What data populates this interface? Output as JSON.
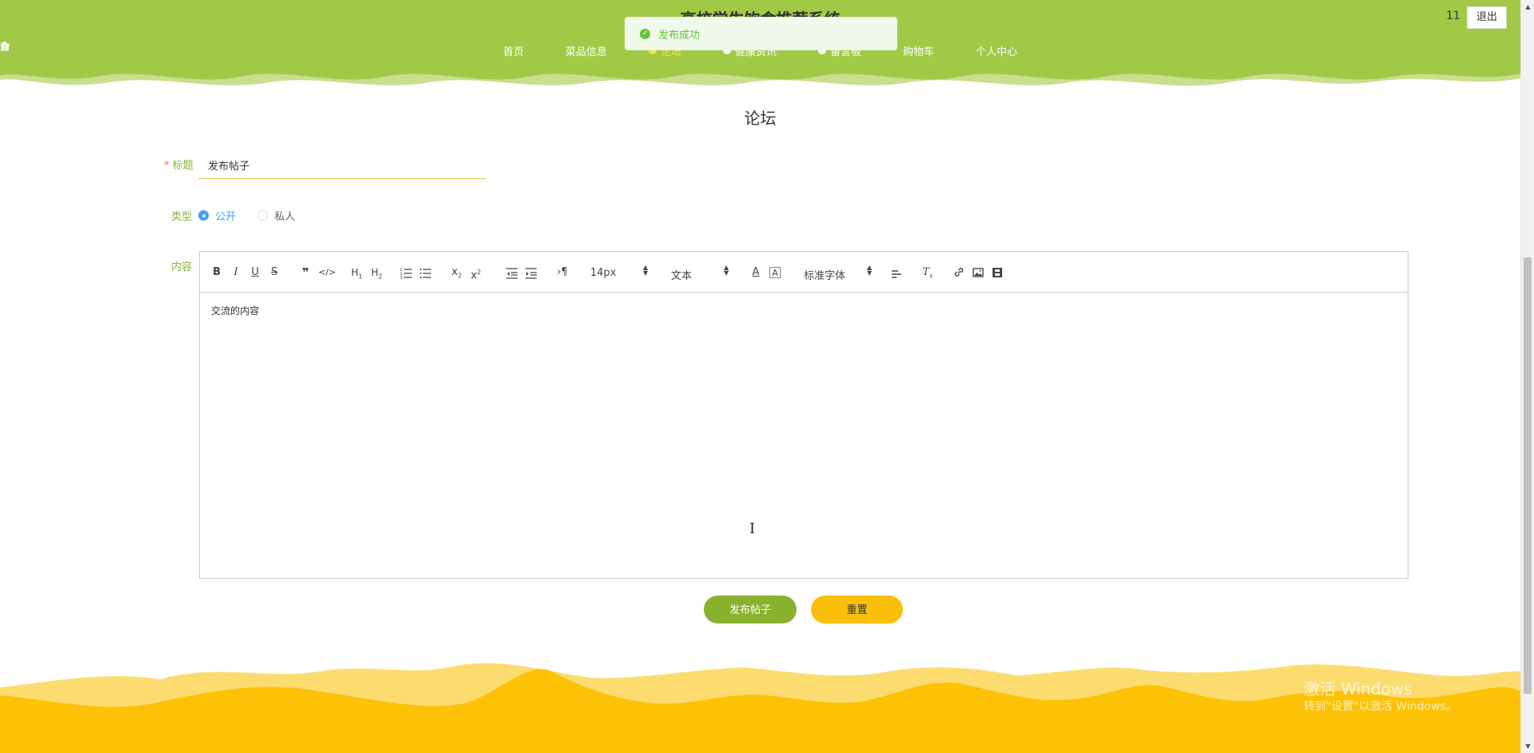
{
  "header": {
    "site_title": "高校学生饮食推荐系统",
    "user_number": "11",
    "logout_label": "退出",
    "nav": [
      {
        "label": "首页",
        "icon": "star-icon",
        "active": false
      },
      {
        "label": "菜品信息",
        "icon": "bag-icon",
        "active": false
      },
      {
        "label": "论坛",
        "icon": "dot-icon",
        "active": true
      },
      {
        "label": "健康资讯",
        "icon": "dot-icon",
        "active": false
      },
      {
        "label": "留言板",
        "icon": "dot-icon",
        "active": false
      },
      {
        "label": "购物车",
        "icon": "cart-icon",
        "active": false
      },
      {
        "label": "个人中心",
        "icon": "user-icon",
        "active": false
      }
    ]
  },
  "toast": {
    "message": "发布成功",
    "icon": "success-check-icon"
  },
  "page": {
    "title": "论坛"
  },
  "form": {
    "title_label": "标题",
    "title_required_mark": "*",
    "title_value": "发布帖子",
    "type_label": "类型",
    "type_options": [
      {
        "label": "公开",
        "checked": true
      },
      {
        "label": "私人",
        "checked": false
      }
    ],
    "content_label": "内容",
    "content_value": "交流的内容",
    "toolbar": {
      "font_size": "14px",
      "heading": "文本",
      "font_family": "标准字体"
    },
    "submit_label": "发布帖子",
    "reset_label": "重置"
  },
  "watermark": {
    "line1": "激活 Windows",
    "line2": "转到\"设置\"以激活 Windows。"
  },
  "colors": {
    "header_green": "#a2c946",
    "footer_yellow": "#fdc105",
    "accent_green": "#8ab12e",
    "accent_yellow": "#f9bf0a"
  }
}
